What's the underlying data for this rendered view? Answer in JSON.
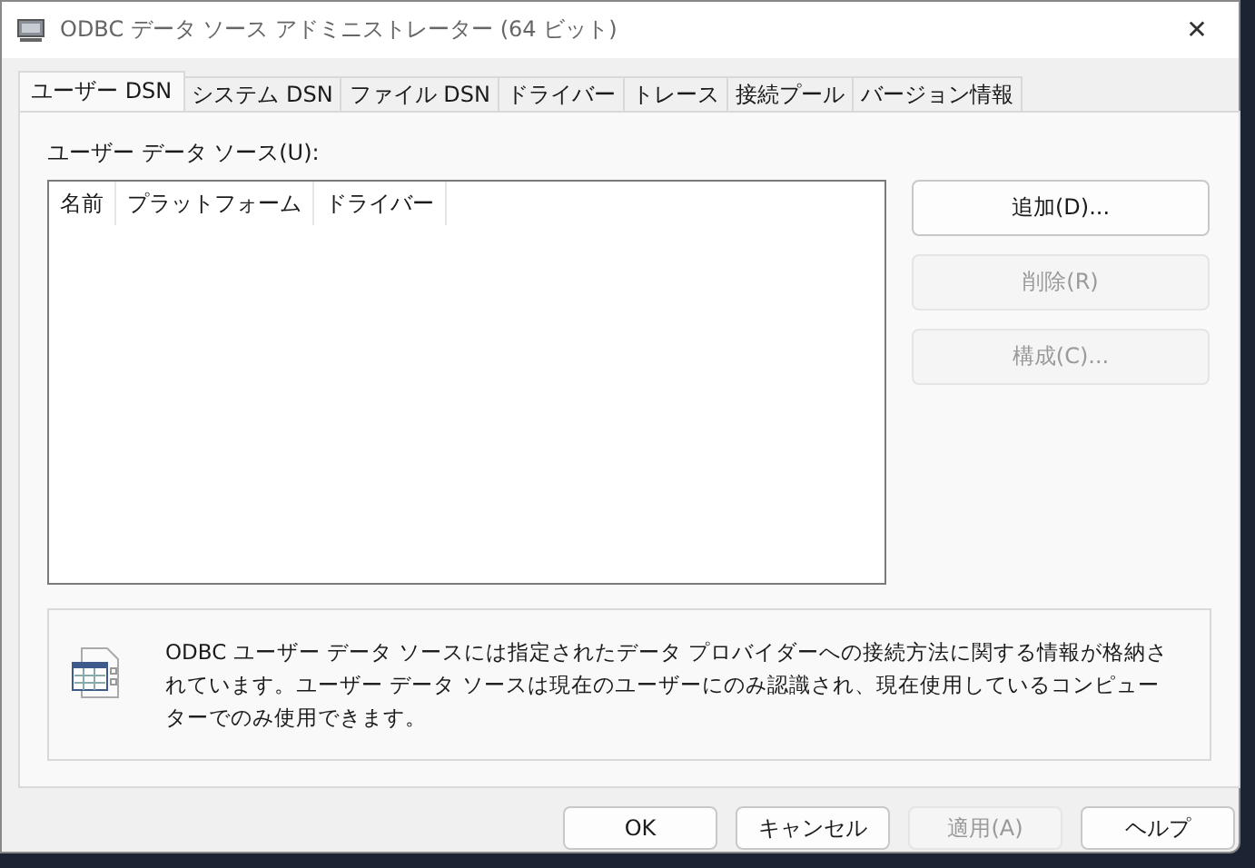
{
  "window": {
    "title": "ODBC データ ソース アドミニストレーター (64 ビット)",
    "close": "✕"
  },
  "tabs": [
    {
      "label": "ユーザー DSN",
      "selected": true
    },
    {
      "label": "システム DSN",
      "selected": false
    },
    {
      "label": "ファイル DSN",
      "selected": false
    },
    {
      "label": "ドライバー",
      "selected": false
    },
    {
      "label": "トレース",
      "selected": false
    },
    {
      "label": "接続プール",
      "selected": false
    },
    {
      "label": "バージョン情報",
      "selected": false
    }
  ],
  "list": {
    "label": "ユーザー データ ソース(U):",
    "columns": [
      "名前",
      "プラットフォーム",
      "ドライバー"
    ]
  },
  "side_buttons": [
    {
      "label": "追加(D)...",
      "disabled": false
    },
    {
      "label": "削除(R)",
      "disabled": true
    },
    {
      "label": "構成(C)...",
      "disabled": true
    }
  ],
  "info": {
    "text": "ODBC ユーザー データ ソースには指定されたデータ プロバイダーへの接続方法に関する情報が格納されています。ユーザー データ ソースは現在のユーザーにのみ認識され、現在使用しているコンピューターでのみ使用できます。"
  },
  "buttons": [
    {
      "label": "OK",
      "disabled": false
    },
    {
      "label": "キャンセル",
      "disabled": false
    },
    {
      "label": "適用(A)",
      "disabled": true
    },
    {
      "label": "ヘルプ",
      "disabled": false
    }
  ]
}
